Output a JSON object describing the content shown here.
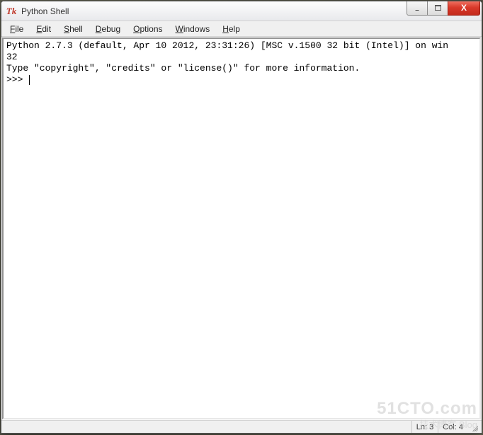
{
  "window": {
    "title": "Python Shell",
    "icon_glyph": "Tk"
  },
  "menubar": {
    "items": [
      {
        "label": "File",
        "accel": "F"
      },
      {
        "label": "Edit",
        "accel": "E"
      },
      {
        "label": "Shell",
        "accel": "S"
      },
      {
        "label": "Debug",
        "accel": "D"
      },
      {
        "label": "Options",
        "accel": "O"
      },
      {
        "label": "Windows",
        "accel": "W"
      },
      {
        "label": "Help",
        "accel": "H"
      }
    ]
  },
  "shell": {
    "banner_line1": "Python 2.7.3 (default, Apr 10 2012, 23:31:26) [MSC v.1500 32 bit (Intel)] on win",
    "banner_line2": "32",
    "banner_line3": "Type \"copyright\", \"credits\" or \"license()\" for more information.",
    "prompt": ">>> "
  },
  "status": {
    "line": "Ln: 3",
    "col": "Col: 4"
  },
  "watermark": {
    "main": "51CTO.com",
    "sub": "技术博客  Blog"
  },
  "controls": {
    "minimize": "–",
    "maximize": "max",
    "close": "X"
  }
}
